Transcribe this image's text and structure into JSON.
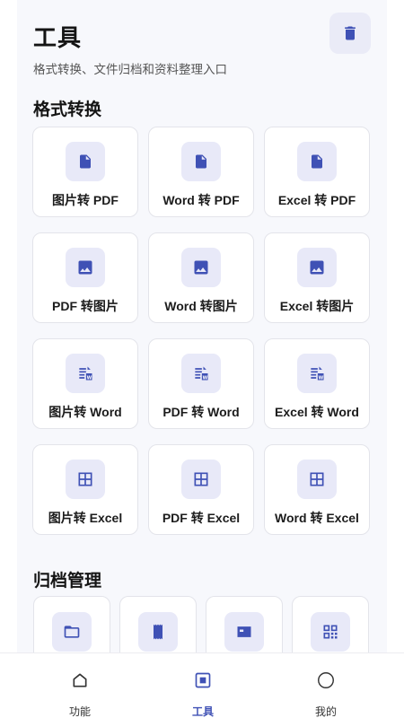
{
  "header": {
    "title": "工具",
    "subtitle": "格式转换、文件归档和资料整理入口",
    "trash_icon": "trash-icon"
  },
  "accent_color": "#3f51b5",
  "format_section": {
    "title": "格式转换",
    "items": [
      {
        "label": "图片转 PDF",
        "icon": "file-icon"
      },
      {
        "label": "Word 转 PDF",
        "icon": "file-icon"
      },
      {
        "label": "Excel 转 PDF",
        "icon": "file-icon"
      },
      {
        "label": "PDF 转图片",
        "icon": "image-icon"
      },
      {
        "label": "Word 转图片",
        "icon": "image-icon"
      },
      {
        "label": "Excel 转图片",
        "icon": "image-icon"
      },
      {
        "label": "图片转 Word",
        "icon": "word-doc-icon"
      },
      {
        "label": "PDF 转 Word",
        "icon": "word-doc-icon"
      },
      {
        "label": "Excel 转 Word",
        "icon": "word-doc-icon"
      },
      {
        "label": "图片转 Excel",
        "icon": "table-icon"
      },
      {
        "label": "PDF 转 Excel",
        "icon": "table-icon"
      },
      {
        "label": "Word 转 Excel",
        "icon": "table-icon"
      }
    ]
  },
  "archive_section": {
    "title": "归档管理",
    "items": [
      {
        "icon": "folder-icon"
      },
      {
        "icon": "receipt-icon"
      },
      {
        "icon": "card-icon"
      },
      {
        "icon": "qr-code-icon"
      }
    ]
  },
  "bottom_nav": {
    "items": [
      {
        "label": "功能",
        "icon": "home-icon",
        "active": false
      },
      {
        "label": "工具",
        "icon": "tools-icon",
        "active": true
      },
      {
        "label": "我的",
        "icon": "profile-icon",
        "active": false
      }
    ]
  }
}
